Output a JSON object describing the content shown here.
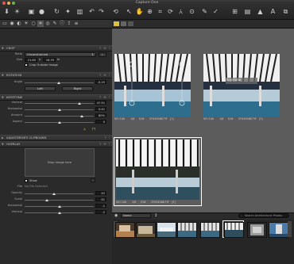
{
  "window": {
    "title": "Capture One"
  },
  "sections": {
    "crop": "CROP",
    "rotation": "ROTATION",
    "keystone": "KEYSTONE",
    "adjustments_clipboard": "ADJUSTMENTS CLIPBOARD",
    "overlay": "OVERLAY"
  },
  "crop": {
    "ratio_label": "Ratio",
    "ratio_value": "Unconstrained",
    "size_label": "Size",
    "width": "21.85",
    "x": "x",
    "height": "16.39",
    "unit": "in",
    "outside_label": "Crop Outside Image"
  },
  "rotation": {
    "angle_label": "Angle",
    "angle_value": "-0.25",
    "left_btn": "Left",
    "right_btn": "Right"
  },
  "keystone": {
    "rows": [
      {
        "label": "Vertical",
        "value": "47.51"
      },
      {
        "label": "Horizontal",
        "value": "0.41"
      },
      {
        "label": "Amount",
        "value": "80%"
      },
      {
        "label": "Aspect",
        "value": "0"
      }
    ]
  },
  "overlay": {
    "drop_text": "Drop image here",
    "show_label": "Show",
    "file_label": "File",
    "file_value": "No File Selected",
    "rows": [
      {
        "label": "Opacity",
        "value": "42"
      },
      {
        "label": "Scale",
        "value": "61"
      },
      {
        "label": "Horizontal",
        "value": "-1"
      },
      {
        "label": "Vertical",
        "value": "-2"
      }
    ]
  },
  "viewer": {
    "captions": [
      {
        "iso": "ISO 100",
        "exp": "1/8",
        "f": "f/16",
        "file": "CF034568.TIF",
        "num": "[1]"
      },
      {
        "iso": "ISO 100",
        "exp": "1/8",
        "f": "f/16",
        "file": "CF034568.TIF",
        "num": "[2]"
      },
      {
        "iso": "ISO 100",
        "exp": "1/8",
        "f": "f/16",
        "file": "CF034568.TIF",
        "num": "[3]"
      }
    ],
    "keystone_tag": "Keystone"
  },
  "browser": {
    "sort_label": "Name",
    "search_placeholder": "Search Architectural Photos"
  },
  "colors": {
    "accent": "#e0c040",
    "selection": "#ffffff"
  }
}
